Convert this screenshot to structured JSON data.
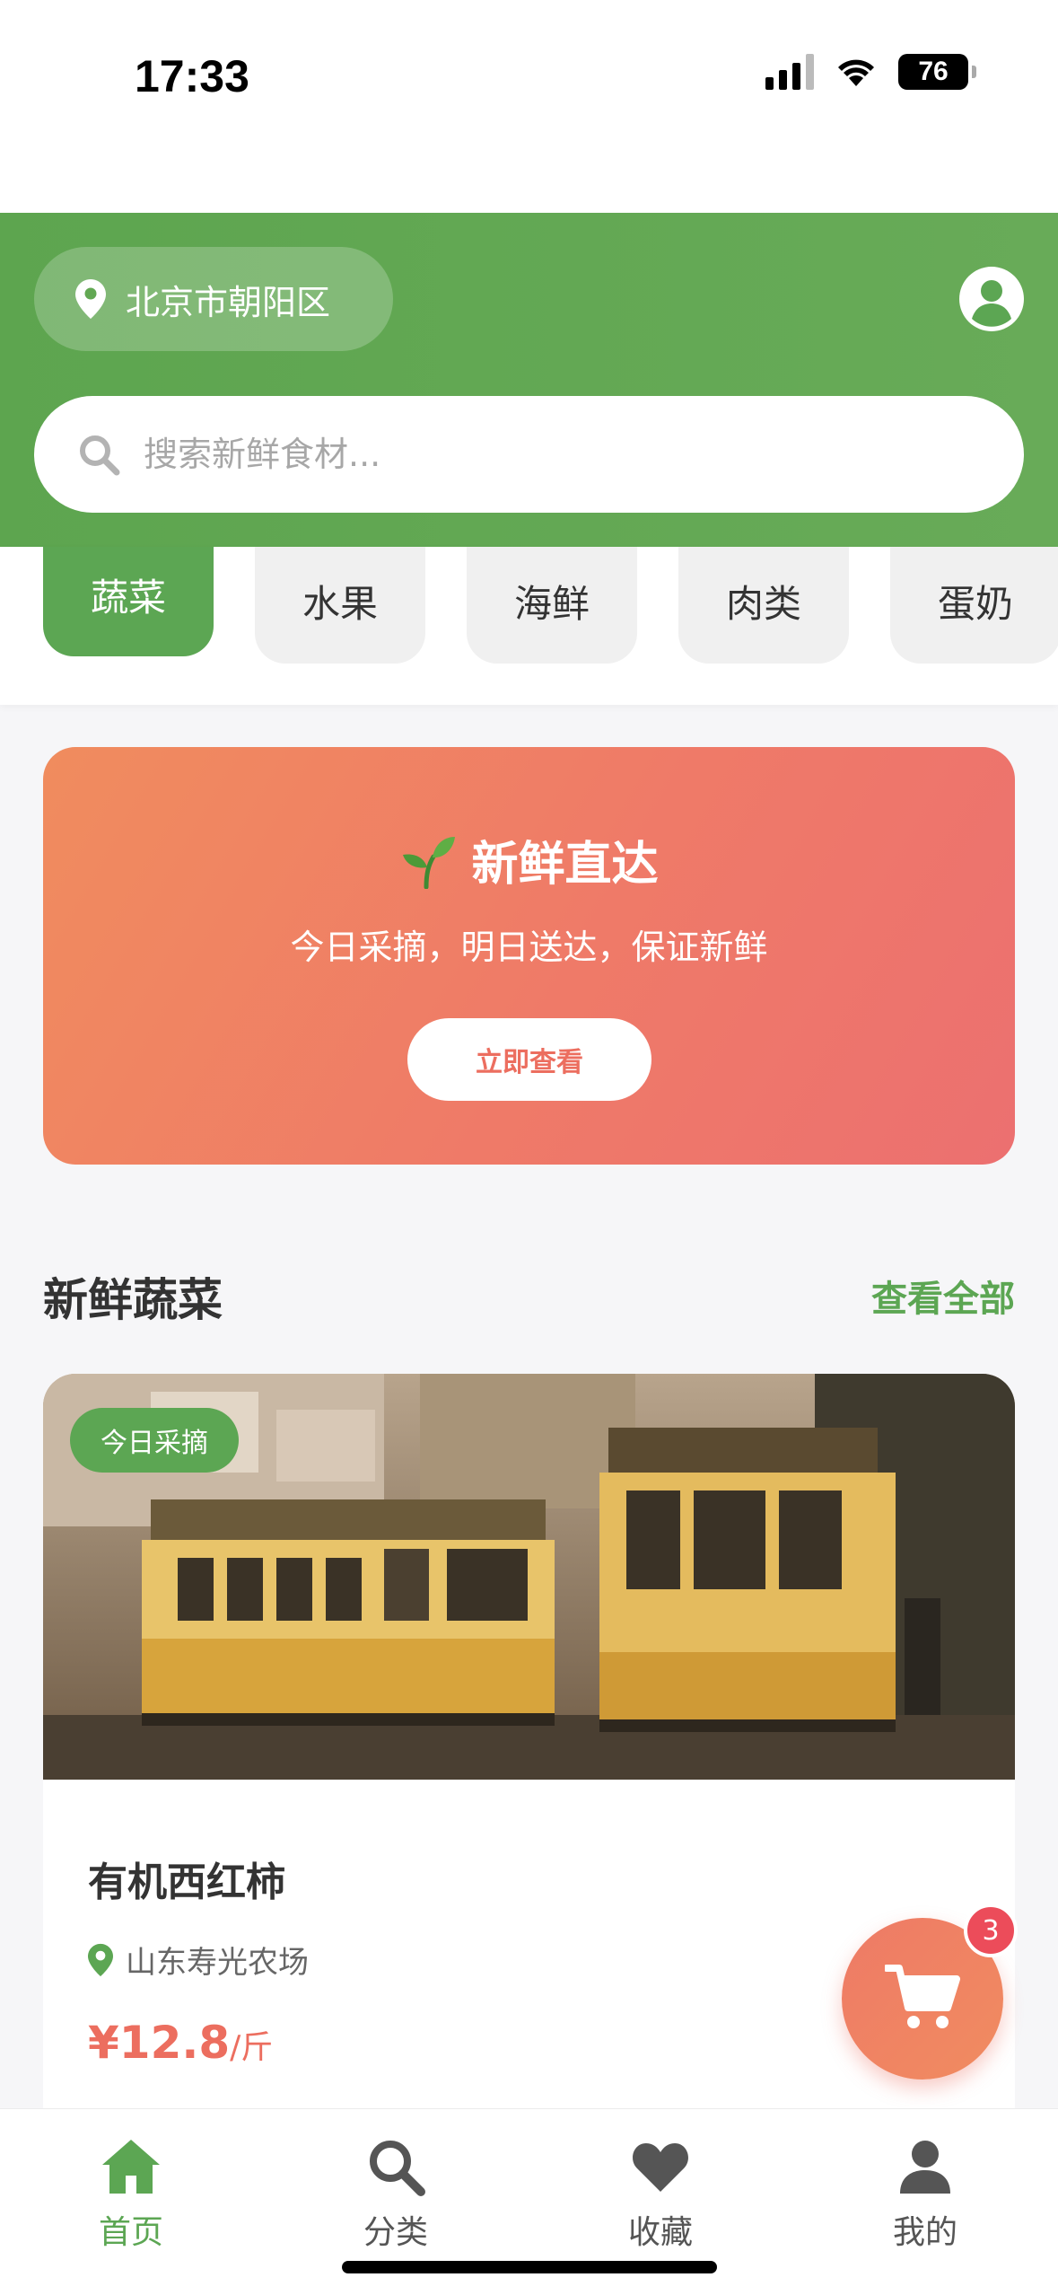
{
  "status_bar": {
    "time": "17:33",
    "battery": "76"
  },
  "header": {
    "location": "北京市朝阳区",
    "search_placeholder": "搜索新鲜食材..."
  },
  "categories": [
    {
      "label": "蔬菜",
      "active": true
    },
    {
      "label": "水果",
      "active": false
    },
    {
      "label": "海鲜",
      "active": false
    },
    {
      "label": "肉类",
      "active": false
    },
    {
      "label": "蛋奶",
      "active": false
    }
  ],
  "banner": {
    "title": "新鲜直达",
    "subtitle": "今日采摘，明日送达，保证新鲜",
    "button": "立即查看"
  },
  "section": {
    "title": "新鲜蔬菜",
    "link": "查看全部"
  },
  "product": {
    "badge": "今日采摘",
    "name": "有机西红柿",
    "farm": "山东寿光农场",
    "price": "¥12.8",
    "unit": "/斤"
  },
  "cart": {
    "count": "3"
  },
  "bottom_nav": [
    {
      "label": "首页",
      "icon": "home-icon",
      "active": true
    },
    {
      "label": "分类",
      "icon": "search-icon",
      "active": false
    },
    {
      "label": "收藏",
      "icon": "heart-icon",
      "active": false
    },
    {
      "label": "我的",
      "icon": "user-icon",
      "active": false
    }
  ],
  "colors": {
    "brand_green": "#5ca653",
    "accent_orange": "#ec6e5f",
    "badge_red": "#ec4c5a"
  }
}
